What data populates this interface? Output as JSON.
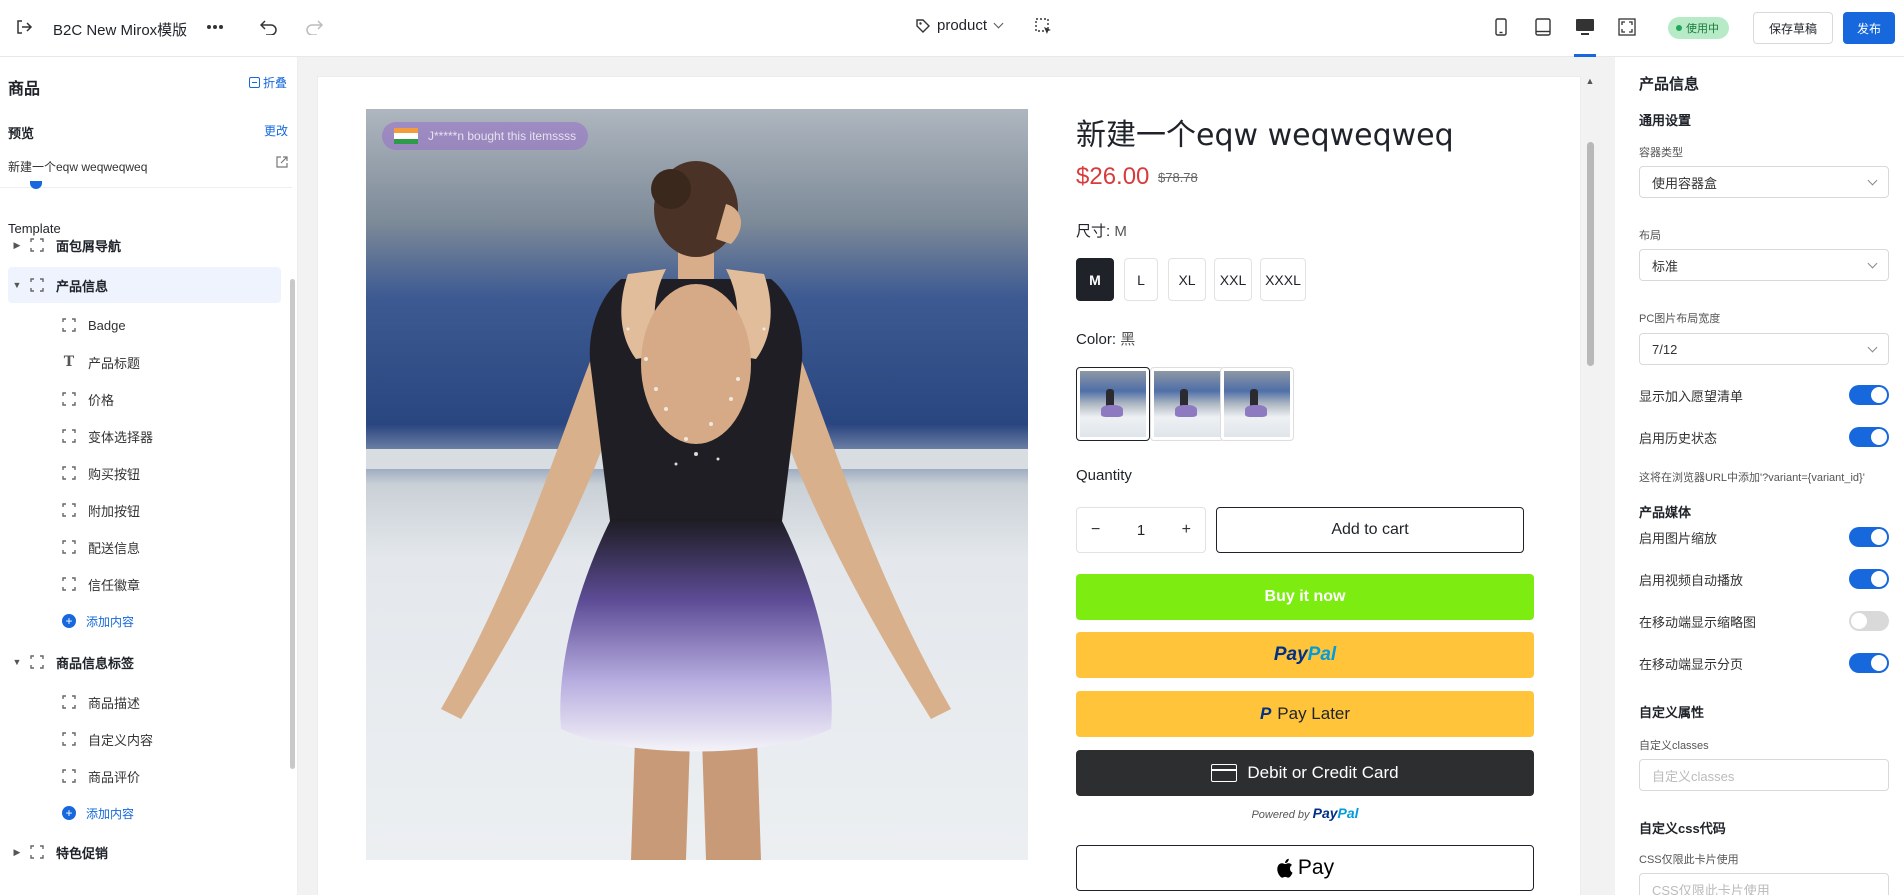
{
  "header": {
    "app_title": "B2C New Mirox模版",
    "page_selector": "product",
    "status": "使用中",
    "save_draft": "保存草稿",
    "publish": "发布"
  },
  "left_panel": {
    "title": "商品",
    "collapse": "折叠",
    "preview_label": "预览",
    "change": "更改",
    "preview_product": "新建一个eqw weqweqweq",
    "template_label": "Template",
    "tree": [
      {
        "label": "面包屑导航",
        "level": 0
      },
      {
        "label": "产品信息",
        "level": 0,
        "expanded": true,
        "selected": true
      },
      {
        "label": "Badge",
        "level": 1
      },
      {
        "label": "产品标题",
        "level": 1,
        "icon": "text-icon"
      },
      {
        "label": "价格",
        "level": 1
      },
      {
        "label": "变体选择器",
        "level": 1
      },
      {
        "label": "购买按钮",
        "level": 1
      },
      {
        "label": "附加按钮",
        "level": 1
      },
      {
        "label": "配送信息",
        "level": 1
      },
      {
        "label": "信任徽章",
        "level": 1
      },
      {
        "label": "添加内容",
        "level": 1,
        "add": true
      },
      {
        "label": "商品信息标签",
        "level": 0,
        "expanded": true
      },
      {
        "label": "商品描述",
        "level": 1
      },
      {
        "label": "自定义内容",
        "level": 1
      },
      {
        "label": "商品评价",
        "level": 1
      },
      {
        "label": "添加内容",
        "level": 1,
        "add": true
      },
      {
        "label": "特色促销",
        "level": 0,
        "expanded": false
      }
    ]
  },
  "product": {
    "title": "新建一个eqw weqweqweq",
    "price": "$26.00",
    "compare_price": "$78.78",
    "bought_notice": "J*****n bought this itemssss",
    "size_label": "尺寸:",
    "size_value": "M",
    "sizes": [
      "M",
      "L",
      "XL",
      "XXL",
      "XXXL"
    ],
    "selected_size": "M",
    "color_label": "Color:",
    "color_value": "黑",
    "quantity_label": "Quantity",
    "quantity": "1",
    "add_to_cart": "Add to cart",
    "buy_now": "Buy it now",
    "paypal_a": "Pay",
    "paypal_b": "Pal",
    "pay_later": "Pay Later",
    "debit_credit": "Debit or Credit Card",
    "powered_by": "Powered by",
    "apple_pay": "Pay"
  },
  "right_panel": {
    "title": "产品信息",
    "general": "通用设置",
    "container_type_label": "容器类型",
    "container_type": "使用容器盒",
    "layout_label": "布局",
    "layout": "标准",
    "pc_width_label": "PC图片布局宽度",
    "pc_width": "7/12",
    "toggles_1": [
      {
        "label": "显示加入愿望清单",
        "on": true
      },
      {
        "label": "启用历史状态",
        "on": true
      }
    ],
    "history_note": "这将在浏览器URL中添加'?variant={variant_id}'",
    "media_section": "产品媒体",
    "toggles_2": [
      {
        "label": "启用图片缩放",
        "on": true
      },
      {
        "label": "启用视频自动播放",
        "on": true
      },
      {
        "label": "在移动端显示缩略图",
        "on": false
      },
      {
        "label": "在移动端显示分页",
        "on": true
      }
    ],
    "custom_section": "自定义属性",
    "custom_classes_label": "自定义classes",
    "custom_classes_placeholder": "自定义classes",
    "custom_css_section": "自定义css代码",
    "css_label": "CSS仅限此卡片使用",
    "css_placeholder": "CSS仅限此卡片使用"
  },
  "colors": {
    "accent": "#1668dc",
    "buy_now": "#7cec11",
    "paypal": "#ffc439",
    "price": "#d83b3b"
  }
}
